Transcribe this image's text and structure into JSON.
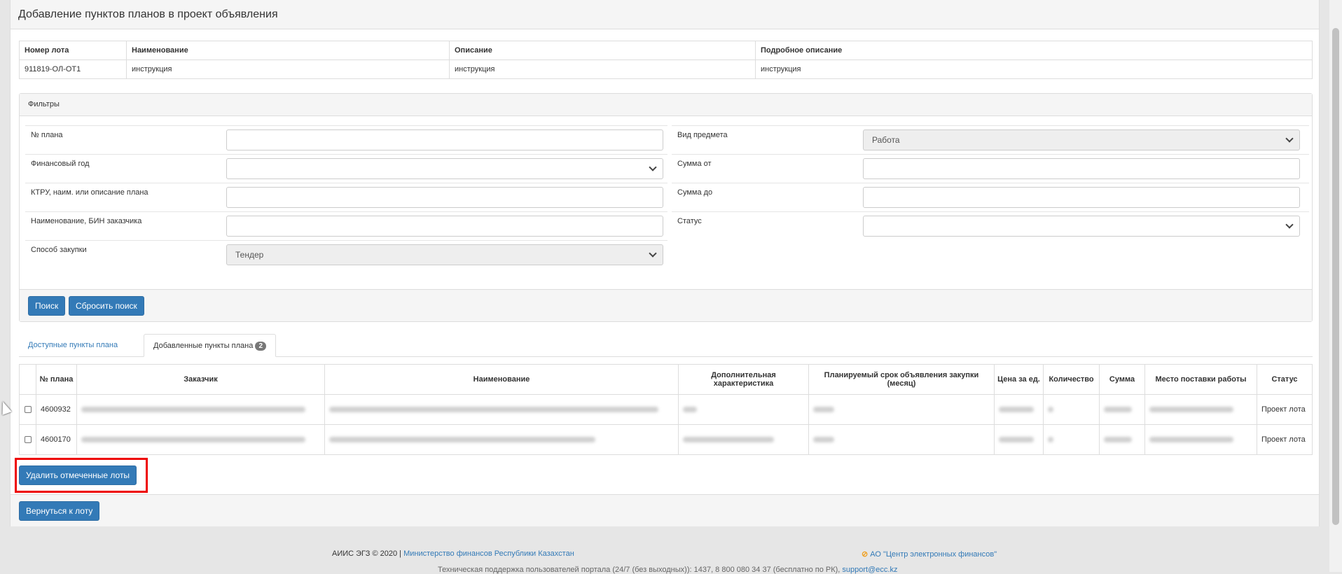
{
  "page": {
    "title": "Добавление пунктов планов в проект объявления"
  },
  "lot_table": {
    "headers": [
      "Номер лота",
      "Наименование",
      "Описание",
      "Подробное описание"
    ],
    "row": [
      "911819-ОЛ-ОТ1",
      "инструкция",
      "инструкция",
      "инструкция"
    ]
  },
  "filters": {
    "title": "Фильтры",
    "plan_no_label": "№ плана",
    "fin_year_label": "Финансовый год",
    "ktru_label": "КТРУ, наим. или описание плана",
    "customer_label": "Наименование, БИН заказчика",
    "method_label": "Способ закупки",
    "method_value": "Тендер",
    "subject_type_label": "Вид предмета",
    "subject_type_value": "Работа",
    "sum_from_label": "Сумма от",
    "sum_to_label": "Сумма до",
    "status_label": "Статус",
    "search_button": "Поиск",
    "reset_button": "Сбросить поиск"
  },
  "tabs": {
    "available": "Доступные пункты плана",
    "added": "Добавленные пункты плана",
    "added_count": "2"
  },
  "items_table": {
    "headers": [
      "№ плана",
      "Заказчик",
      "Наименование",
      "Дополнительная характеристика",
      "Планируемый срок объявления закупки (месяц)",
      "Цена за ед.",
      "Количество",
      "Сумма",
      "Место поставки работы",
      "Статус"
    ],
    "rows": [
      {
        "plan_no": "4600932",
        "status": "Проект лота"
      },
      {
        "plan_no": "4600170",
        "status": "Проект лота"
      }
    ]
  },
  "actions": {
    "delete_button": "Удалить отмеченные лоты",
    "back_button": "Вернуться к лоту"
  },
  "footer": {
    "copyright": "АИИС ЭГЗ © 2020 |",
    "ministry_link": "Министерство финансов Республики Казахстан",
    "org_link": "АО \"Центр электронных финансов\"",
    "support": "Техническая поддержка пользователей портала (24/7 (без выходных)): 1437, 8 800 080 34 37 (бесплатно по РК),",
    "support_email": "support@ecc.kz"
  },
  "colors": {
    "primary": "#337ab7",
    "highlight": "#ee0000"
  }
}
